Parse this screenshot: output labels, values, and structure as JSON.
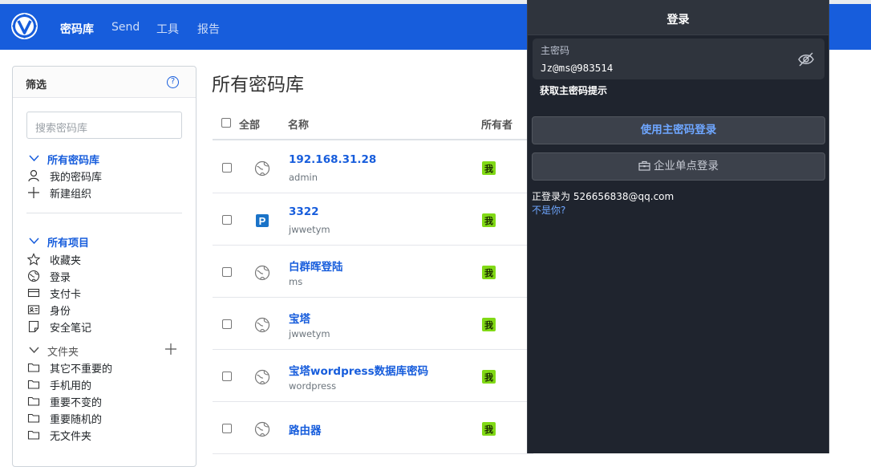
{
  "nav": {
    "vault": "密码库",
    "send": "Send",
    "tools": "工具",
    "reports": "报告"
  },
  "filter": {
    "title": "筛选",
    "search_placeholder": "搜索密码库",
    "all_vaults": "所有密码库",
    "my_vault": "我的密码库",
    "new_org": "新建组织",
    "all_items": "所有项目",
    "types": [
      "收藏夹",
      "登录",
      "支付卡",
      "身份",
      "安全笔记"
    ],
    "folders_label": "文件夹",
    "folders": [
      "其它不重要的",
      "手机用的",
      "重要不变的",
      "重要随机的",
      "无文件夹"
    ]
  },
  "main": {
    "title": "所有密码库",
    "header": {
      "all": "全部",
      "name": "名称",
      "owner": "所有者"
    },
    "rows": [
      {
        "name": "192.168.31.28",
        "sub": "admin",
        "badge": "我",
        "icon": "globe-icon"
      },
      {
        "name": "3322",
        "sub": "jwwetym",
        "badge": "我",
        "icon": "site-favicon-p"
      },
      {
        "name": "白群晖登陆",
        "sub": "ms",
        "badge": "我",
        "icon": "globe-icon"
      },
      {
        "name": "宝塔",
        "sub": "jwwetym",
        "badge": "我",
        "icon": "globe-icon"
      },
      {
        "name": "宝塔wordpress数据库密码",
        "sub": "wordpress",
        "badge": "我",
        "icon": "globe-icon"
      },
      {
        "name": "路由器",
        "sub": "",
        "badge": "我",
        "icon": "globe-icon"
      }
    ]
  },
  "popup": {
    "title": "登录",
    "master_label": "主密码",
    "master_value": "Jz@ms@983514",
    "hint_link": "获取主密码提示",
    "login_button": "使用主密码登录",
    "sso_button": "企业单点登录",
    "logged_in_as": "正登录为 526656838@qq.com",
    "not_you": "不是你?"
  },
  "colors": {
    "brand": "#175ddc",
    "badge": "#81d916",
    "popup_bg": "#1f242e",
    "popup_link": "#6ea6ff"
  }
}
